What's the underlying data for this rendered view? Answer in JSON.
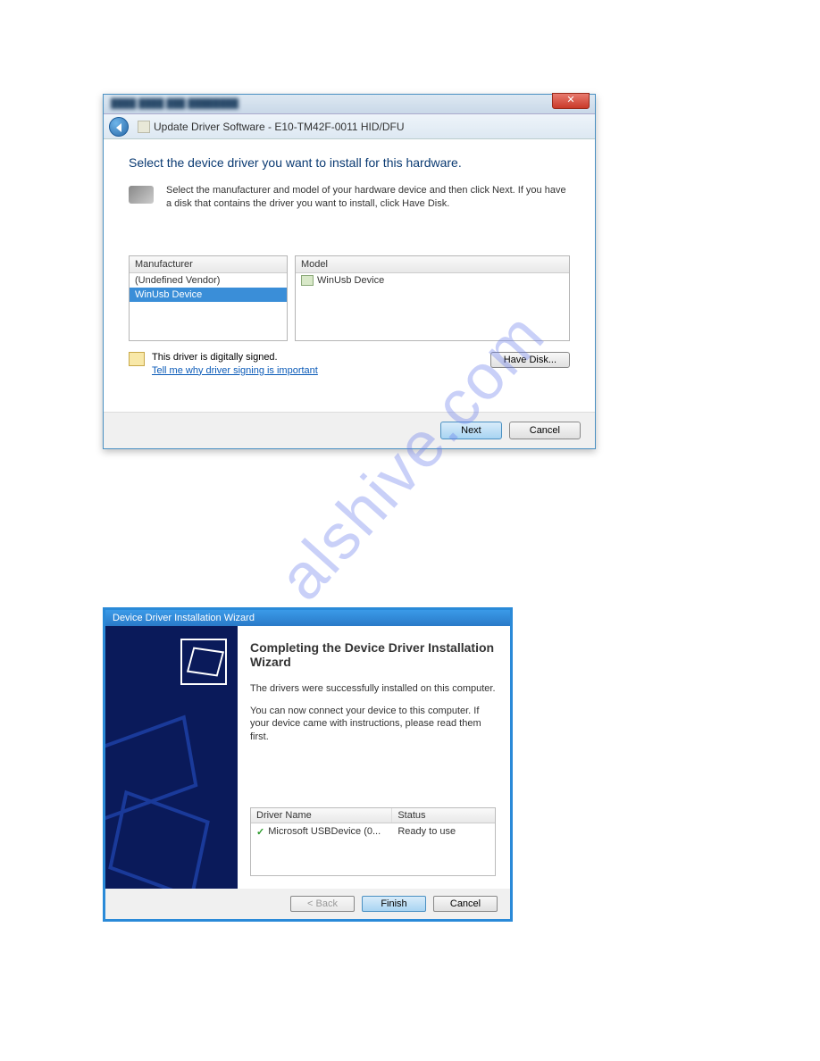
{
  "watermark": "alshive.com",
  "dialog1": {
    "close_glyph": "✕",
    "nav_title": "Update Driver Software - E10-TM42F-0011 HID/DFU",
    "heading": "Select the device driver you want to install for this hardware.",
    "instructions": "Select the manufacturer and model of your hardware device and then click Next. If you have a disk that contains the driver you want to install, click Have Disk.",
    "manufacturer_header": "Manufacturer",
    "model_header": "Model",
    "manufacturers": {
      "item0": "(Undefined Vendor)",
      "item1": "WinUsb Device"
    },
    "models": {
      "item0": "WinUsb Device"
    },
    "signed_text": "This driver is digitally signed.",
    "signing_link": "Tell me why driver signing is important",
    "have_disk_label": "Have Disk...",
    "next_label": "Next",
    "cancel_label": "Cancel"
  },
  "dialog2": {
    "title": "Device Driver Installation Wizard",
    "heading": "Completing the Device Driver Installation Wizard",
    "text1": "The drivers were successfully installed on this computer.",
    "text2": "You can now connect your device to this computer. If your device came with instructions, please read them first.",
    "col_name": "Driver Name",
    "col_status": "Status",
    "row_name": "Microsoft USBDevice  (0...",
    "row_status": "Ready to use",
    "check_glyph": "✓",
    "back_label": "< Back",
    "finish_label": "Finish",
    "cancel_label": "Cancel"
  }
}
